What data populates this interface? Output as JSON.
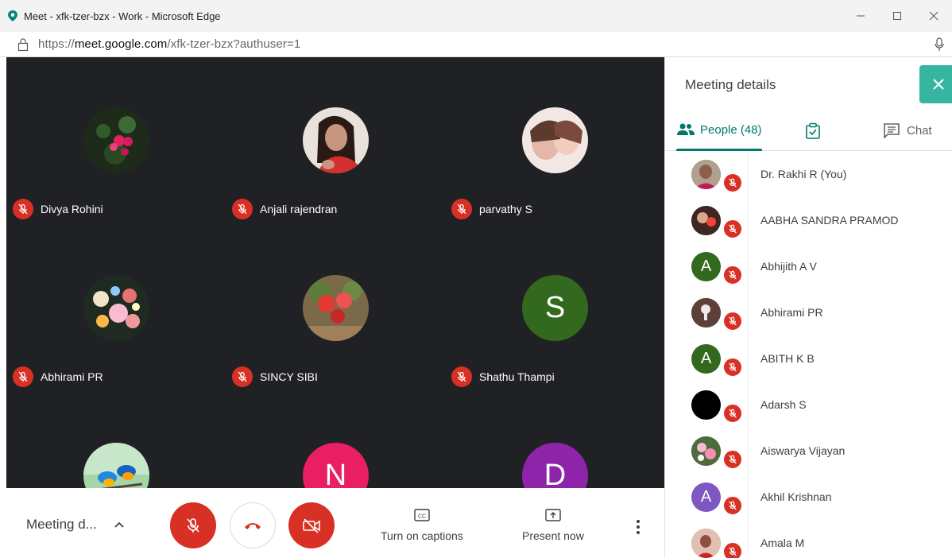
{
  "window": {
    "title": "Meet - xfk-tzer-bzx - Work - Microsoft Edge",
    "url_prefix": "https://",
    "url_domain": "meet.google.com",
    "url_path": "/xfk-tzer-bzx?authuser=1",
    "controls": [
      "minimize-icon",
      "maximize-icon",
      "close-icon"
    ]
  },
  "stage": {
    "tiles": [
      {
        "name": "Divya Rohini",
        "avatar": "photo-flowers-dark"
      },
      {
        "name": "Anjali rajendran",
        "avatar": "photo-person"
      },
      {
        "name": "parvathy S",
        "avatar": "photo-person-light"
      },
      {
        "name": "Abhirami PR",
        "avatar": "photo-floral-painting"
      },
      {
        "name": "SINCY SIBI",
        "avatar": "photo-roses"
      },
      {
        "name": "Shathu Thampi",
        "avatar": "letter",
        "letter": "S",
        "color": "#33691e"
      },
      {
        "name": "",
        "avatar": "photo-birds"
      },
      {
        "name": "",
        "avatar": "letter",
        "letter": "N",
        "color": "#e91e63"
      },
      {
        "name": "",
        "avatar": "letter",
        "letter": "D",
        "color": "#8e24aa"
      }
    ]
  },
  "bottombar": {
    "meeting_details_label": "Meeting d...",
    "captions_label": "Turn on captions",
    "present_label": "Present now"
  },
  "panel": {
    "title": "Meeting details",
    "tabs": {
      "people": "People (48)",
      "chat": "Chat"
    },
    "people": [
      {
        "name": "Dr. Rakhi R (You)",
        "avatar": "photo",
        "color": "#7b5e57"
      },
      {
        "name": "AABHA SANDRA PRAMOD",
        "avatar": "photo",
        "color": "#8d6e63"
      },
      {
        "name": "Abhijith A V",
        "avatar": "letter",
        "letter": "A",
        "color": "#33691e"
      },
      {
        "name": "Abhirami PR",
        "avatar": "photo",
        "color": "#6d4c41"
      },
      {
        "name": "ABITH K B",
        "avatar": "letter",
        "letter": "A",
        "color": "#33691e"
      },
      {
        "name": "Adarsh S",
        "avatar": "letter",
        "letter": "",
        "color": "#000000"
      },
      {
        "name": "Aiswarya Vijayan",
        "avatar": "photo",
        "color": "#6a8a5a"
      },
      {
        "name": "Akhil Krishnan",
        "avatar": "letter",
        "letter": "A",
        "color": "#7e57c2"
      },
      {
        "name": "Amala M",
        "avatar": "photo",
        "color": "#b07a6a"
      }
    ]
  },
  "colors": {
    "accent": "#00796b",
    "mute_red": "#d93025",
    "stage_bg": "#202124",
    "close_teal": "#36b6a0"
  }
}
